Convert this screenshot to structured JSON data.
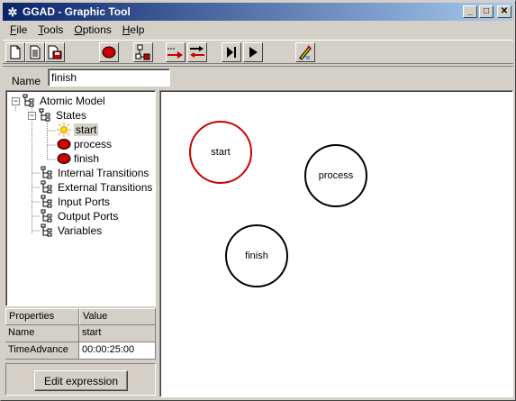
{
  "window": {
    "title": "GGAD - Graphic Tool",
    "app_icon": "gear-icon"
  },
  "menu": [
    "File",
    "Tools",
    "Options",
    "Help"
  ],
  "menu_underline": [
    "F",
    "T",
    "O",
    "H"
  ],
  "name_field": {
    "label": "Name",
    "value": "finish"
  },
  "tree": {
    "root": "Atomic Model",
    "states_label": "States",
    "states": [
      "start",
      "process",
      "finish"
    ],
    "selected_state": "start",
    "sections": [
      "Internal Transitions",
      "External Transitions",
      "Input Ports",
      "Output Ports",
      "Variables"
    ]
  },
  "properties": {
    "headers": [
      "Properties",
      "Value"
    ],
    "rows": [
      {
        "key": "Name",
        "value": "start"
      },
      {
        "key": "TimeAdvance",
        "value": "00:00:25:00"
      }
    ]
  },
  "edit_button": "Edit expression",
  "canvas_states": [
    {
      "label": "start",
      "selected": true
    },
    {
      "label": "process",
      "selected": false
    },
    {
      "label": "finish",
      "selected": false
    }
  ],
  "colors": {
    "title_start": "#0a246a",
    "title_end": "#a6caf0",
    "selected_state": "#cc0000",
    "state_icon": "#cc0000"
  }
}
